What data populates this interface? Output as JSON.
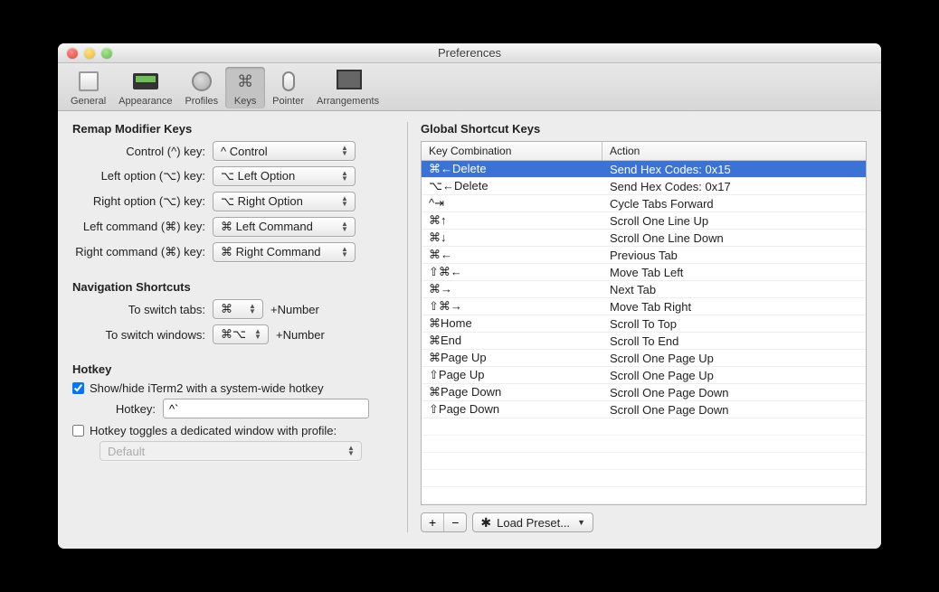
{
  "window": {
    "title": "Preferences"
  },
  "toolbar": {
    "items": [
      {
        "id": "general",
        "label": "General"
      },
      {
        "id": "appearance",
        "label": "Appearance"
      },
      {
        "id": "profiles",
        "label": "Profiles"
      },
      {
        "id": "keys",
        "label": "Keys",
        "selected": true
      },
      {
        "id": "pointer",
        "label": "Pointer"
      },
      {
        "id": "arrangements",
        "label": "Arrangements"
      }
    ]
  },
  "remap": {
    "heading": "Remap Modifier Keys",
    "rows": [
      {
        "label": "Control (^) key:",
        "value": "^ Control"
      },
      {
        "label": "Left option (⌥) key:",
        "value": "⌥ Left Option"
      },
      {
        "label": "Right option (⌥) key:",
        "value": "⌥ Right Option"
      },
      {
        "label": "Left command (⌘) key:",
        "value": "⌘ Left Command"
      },
      {
        "label": "Right command (⌘) key:",
        "value": "⌘ Right Command"
      }
    ]
  },
  "nav": {
    "heading": "Navigation Shortcuts",
    "tabs_label": "To switch tabs:",
    "tabs_value": "⌘",
    "tabs_aux": "+Number",
    "windows_label": "To switch windows:",
    "windows_value": "⌘⌥",
    "windows_aux": "+Number"
  },
  "hotkey": {
    "heading": "Hotkey",
    "show_hide_checked": true,
    "show_hide_label": "Show/hide iTerm2 with a system-wide hotkey",
    "field_label": "Hotkey:",
    "field_value": "^`",
    "toggle_checked": false,
    "toggle_label": "Hotkey toggles a dedicated window with profile:",
    "profile_value": "Default"
  },
  "shortcuts": {
    "heading": "Global Shortcut Keys",
    "columns": {
      "kc": "Key Combination",
      "ac": "Action"
    },
    "rows": [
      {
        "kc": "⌘←Delete",
        "ac": "Send Hex Codes: 0x15",
        "selected": true
      },
      {
        "kc": "⌥←Delete",
        "ac": "Send Hex Codes: 0x17"
      },
      {
        "kc": "^⇥",
        "ac": "Cycle Tabs Forward"
      },
      {
        "kc": "⌘↑",
        "ac": "Scroll One Line Up"
      },
      {
        "kc": "⌘↓",
        "ac": "Scroll One Line Down"
      },
      {
        "kc": "⌘←",
        "ac": "Previous Tab"
      },
      {
        "kc": "⇧⌘←",
        "ac": "Move Tab Left"
      },
      {
        "kc": "⌘→",
        "ac": "Next Tab"
      },
      {
        "kc": "⇧⌘→",
        "ac": "Move Tab Right"
      },
      {
        "kc": "⌘Home",
        "ac": "Scroll To Top"
      },
      {
        "kc": "⌘End",
        "ac": "Scroll To End"
      },
      {
        "kc": "⌘Page Up",
        "ac": "Scroll One Page Up"
      },
      {
        "kc": "⇧Page Up",
        "ac": "Scroll One Page Up"
      },
      {
        "kc": "⌘Page Down",
        "ac": "Scroll One Page Down"
      },
      {
        "kc": "⇧Page Down",
        "ac": "Scroll One Page Down"
      }
    ],
    "empty_rows": 5,
    "add_label": "+",
    "remove_label": "−",
    "preset_label": "Load Preset..."
  }
}
